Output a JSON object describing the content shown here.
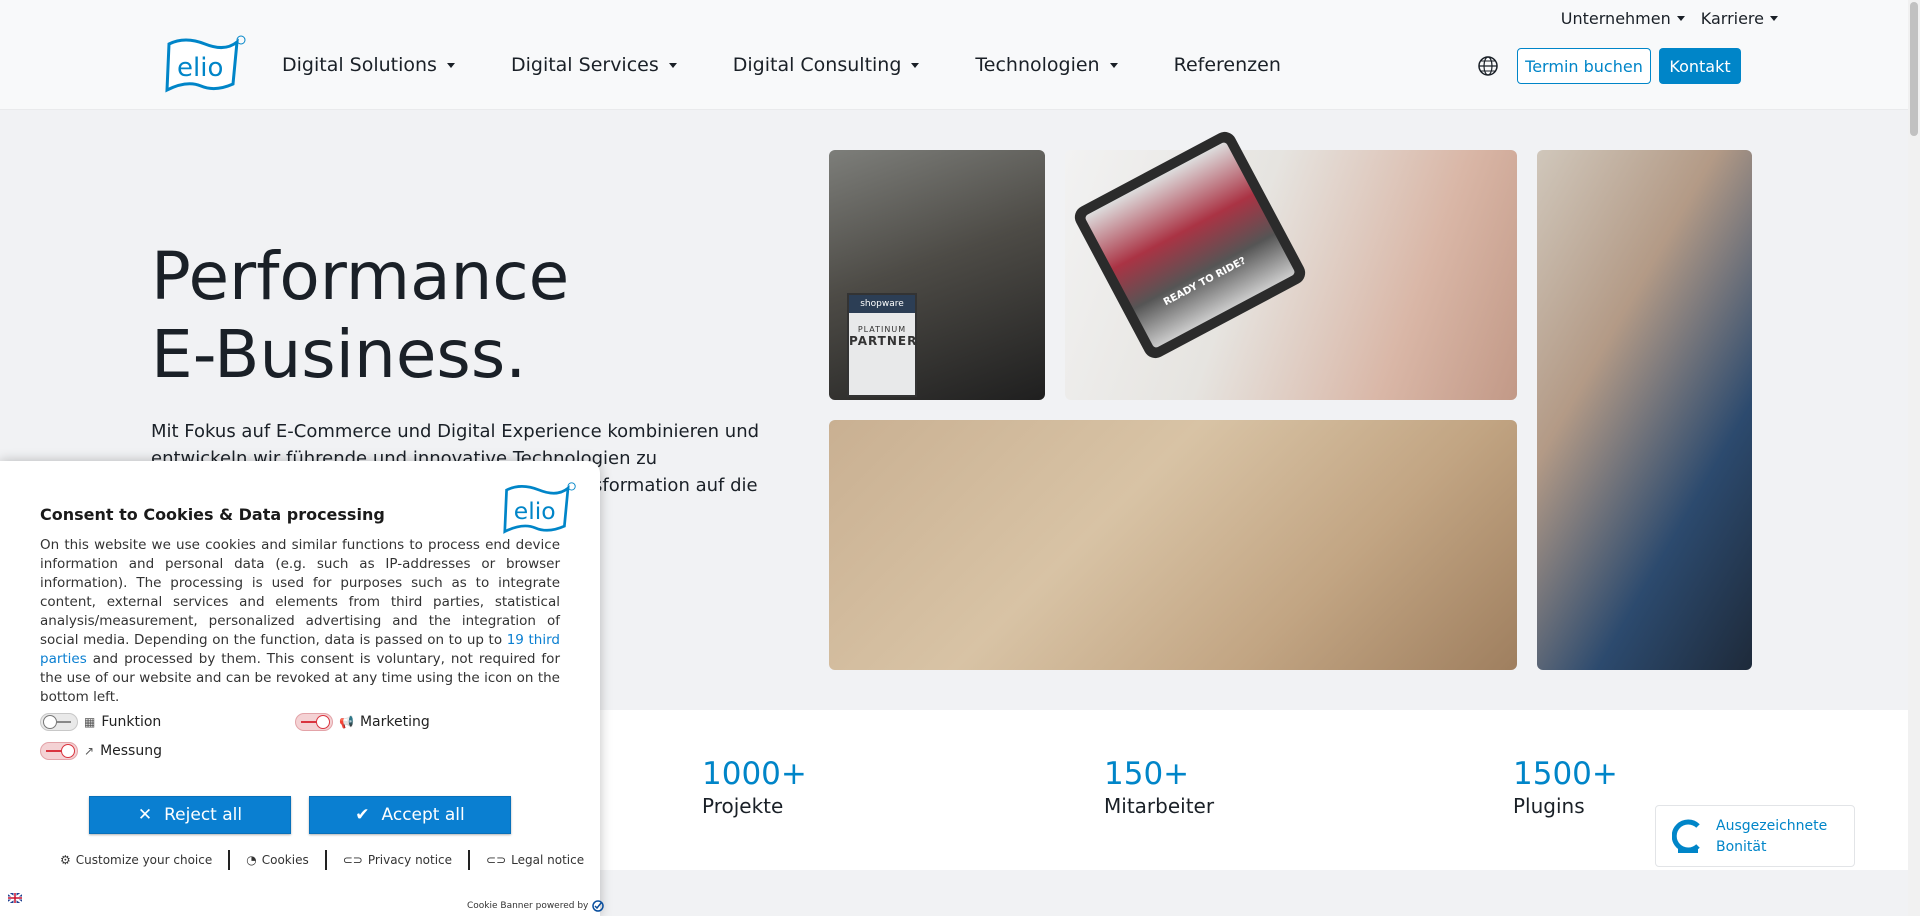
{
  "header": {
    "top_nav": [
      "Unternehmen",
      "Karriere"
    ],
    "main_nav": [
      "Digital Solutions",
      "Digital Services",
      "Digital Consulting",
      "Technologien",
      "Referenzen"
    ],
    "book_button": "Termin buchen",
    "contact_button": "Kontakt",
    "logo_text": "elio"
  },
  "hero": {
    "title_line1": "Performance",
    "title_line2": "E-Business.",
    "text": "Mit Fokus auf E-Commerce und Digital Experience kombinieren und entwickeln wir führende und innovative Technologien zu leistungsstarken",
    "text_partial": "sformation auf die",
    "badge": {
      "brand": "shopware",
      "line1": "PLATINUM",
      "line2": "PARTNER"
    },
    "tablet_text": "READY TO RIDE?"
  },
  "stats": [
    {
      "value": "1000+",
      "label": "Projekte"
    },
    {
      "value": "150+",
      "label": "Mitarbeiter"
    },
    {
      "value": "1500+",
      "label": "Plugins"
    }
  ],
  "bonitaet": {
    "line1": "Ausgezeichnete",
    "line2": "Bonität"
  },
  "consent": {
    "title": "Consent to Cookies & Data processing",
    "body_before_link": "On this website we use cookies and similar functions to process end device information and personal data (e.g. such as IP-addresses or browser information). The processing is used for purposes such as to integrate content, external services and elements from third parties, statistical analysis/measurement, personalized advertising and the integration of social media. Depending on the function, data is passed on to up to ",
    "link_text": "19 third parties",
    "body_after_link": " and processed by them. This consent is voluntary, not required for the use of our website and can be revoked at any time using the icon on the bottom left.",
    "toggles": [
      {
        "label": "Funktion",
        "state": "off"
      },
      {
        "label": "Marketing",
        "state": "off"
      },
      {
        "label": "Messung",
        "state": "off"
      }
    ],
    "reject_label": "Reject all",
    "accept_label": "Accept all",
    "links": [
      "Customize your choice",
      "Cookies",
      "Privacy notice",
      "Legal notice"
    ],
    "footer": "Cookie Banner powered by"
  },
  "colors": {
    "accent": "#0085c8",
    "consent_blue": "#0a7fd1",
    "toggle_red": "#d9343f"
  }
}
